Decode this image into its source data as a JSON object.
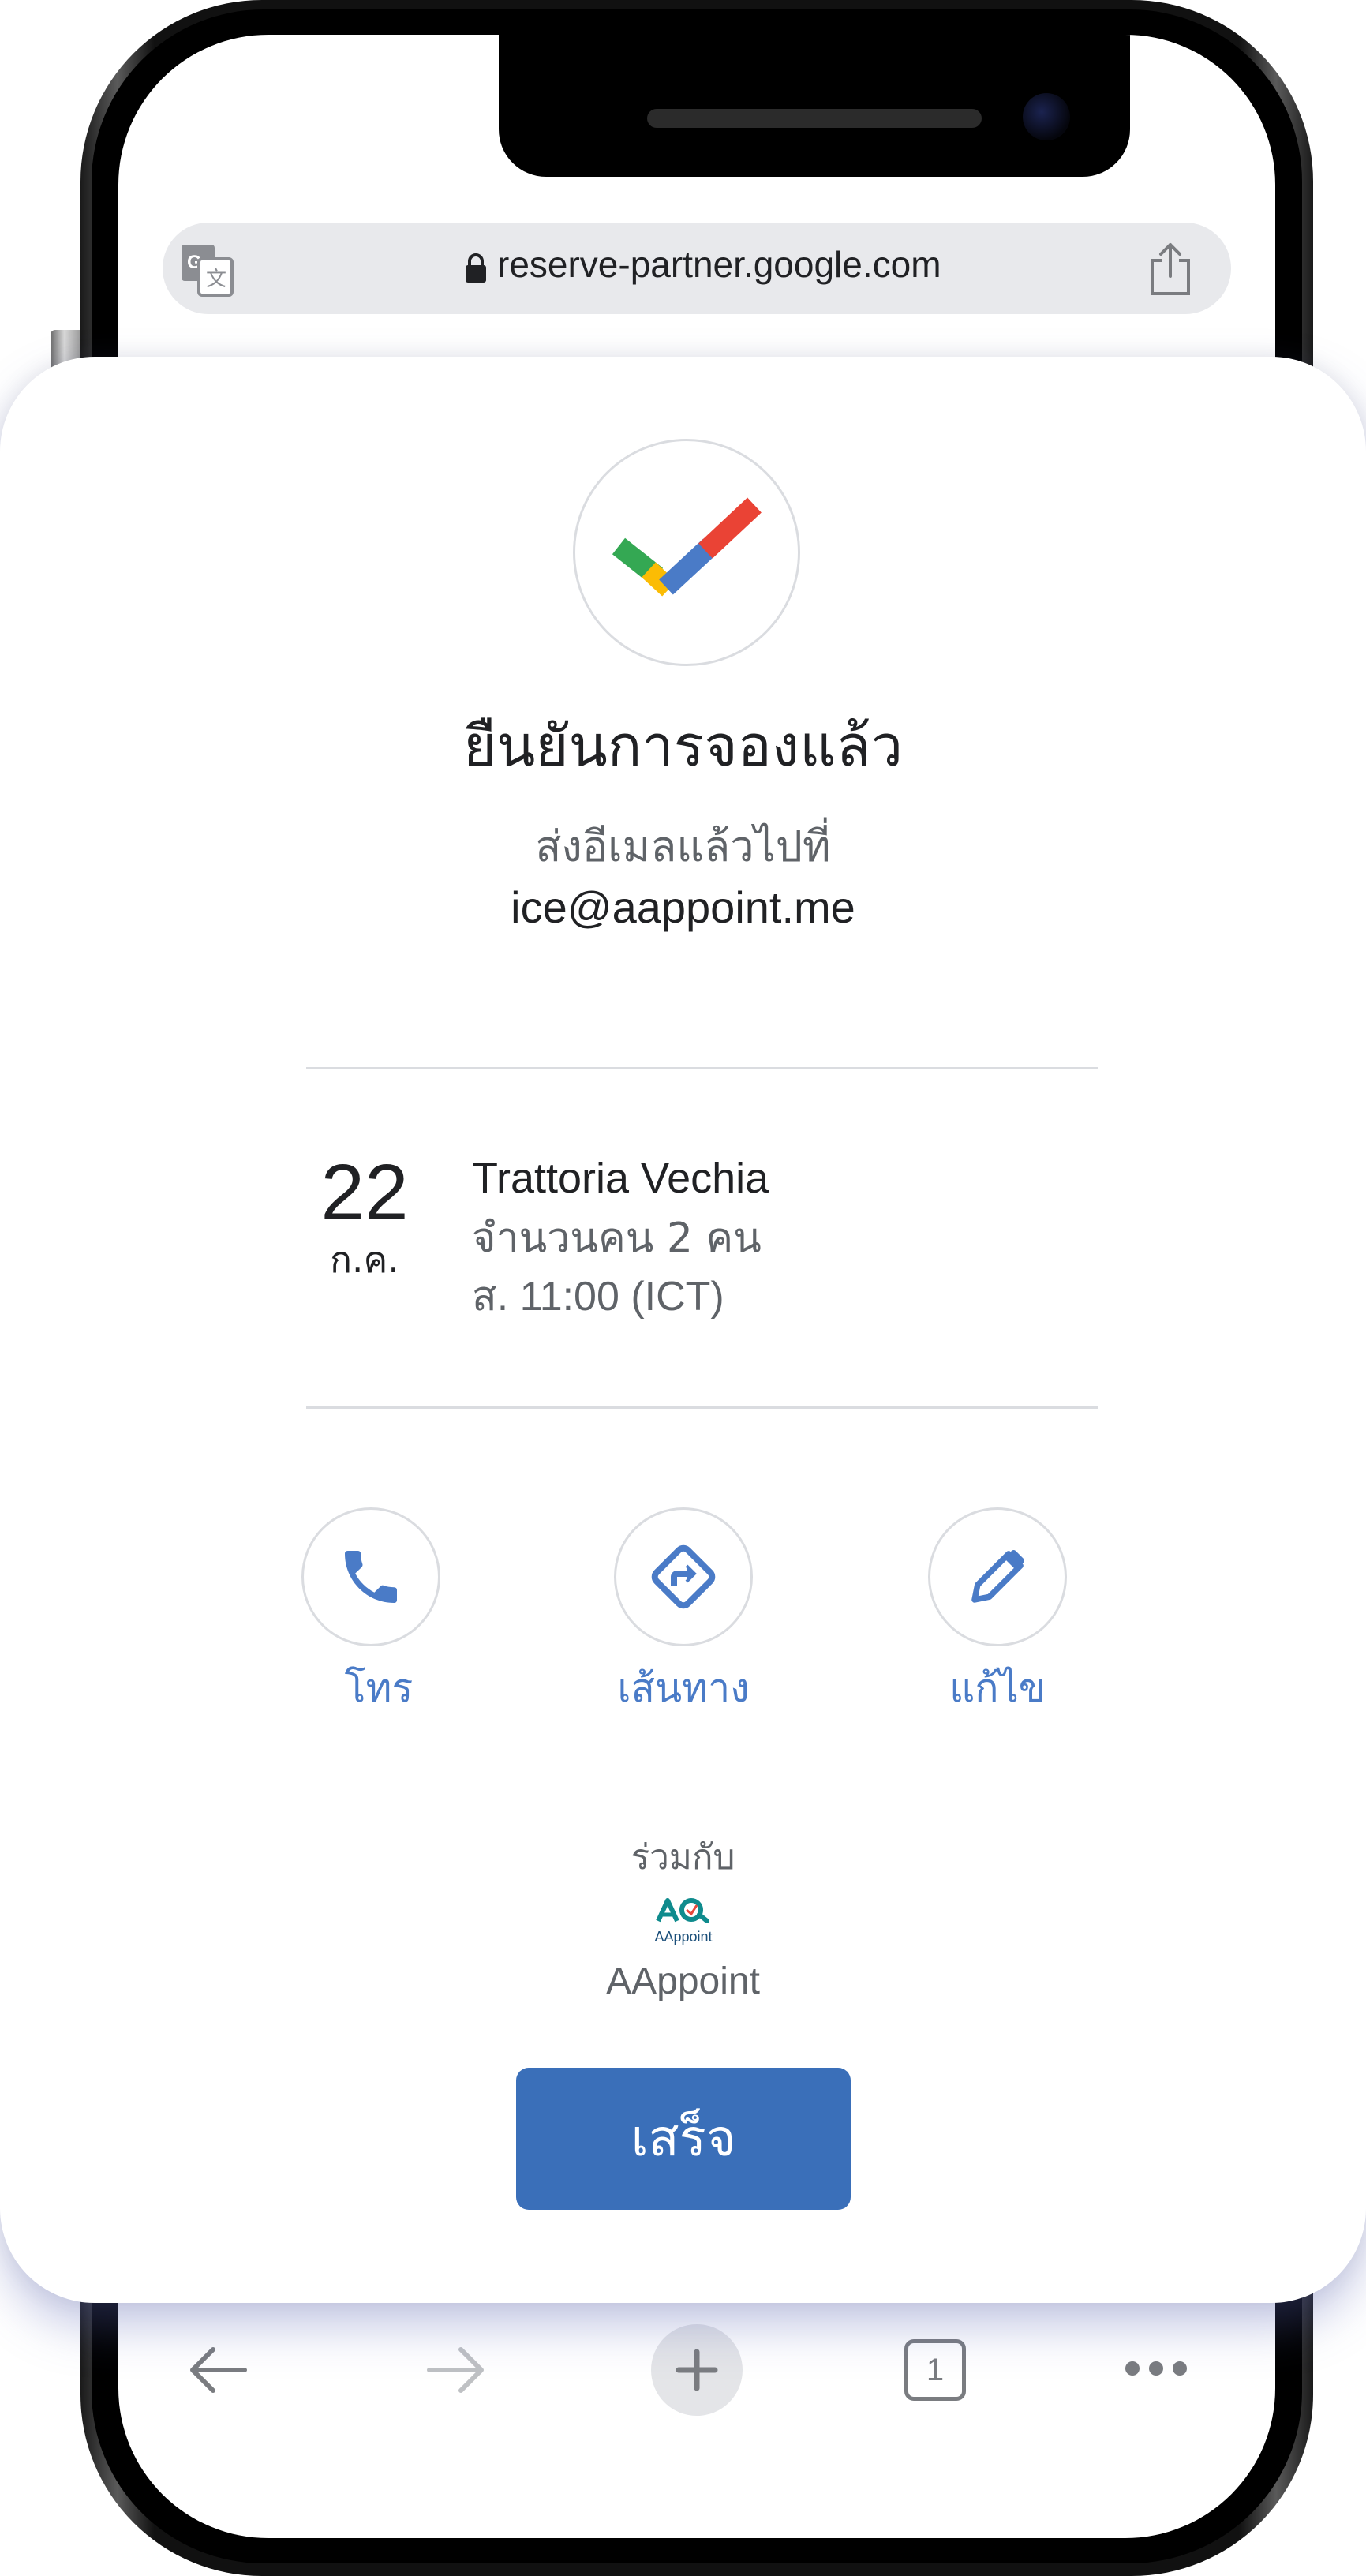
{
  "browser": {
    "url": "reserve-partner.google.com",
    "tab_count": "1",
    "icons": {
      "translate": "translate-icon",
      "lock": "lock-icon",
      "share": "share-icon",
      "back": "arrow-left-icon",
      "forward": "arrow-right-icon",
      "new_tab": "plus-icon",
      "tabs": "tabs-icon",
      "menu": "more-horizontal-icon"
    }
  },
  "confirmation": {
    "title": "ยืนยันการจองแล้ว",
    "sent_to_label": "ส่งอีเมลแล้วไปที่",
    "email": "ice@aappoint.me"
  },
  "booking": {
    "day": "22",
    "month": "ก.ค.",
    "restaurant": "Trattoria Vechia",
    "party": "จำนวนคน 2 คน",
    "time": "ส.  11:00  (ICT)"
  },
  "actions": [
    {
      "label": "โทร",
      "icon": "phone-icon"
    },
    {
      "label": "เส้นทาง",
      "icon": "directions-icon"
    },
    {
      "label": "แก้ไข",
      "icon": "pencil-icon"
    }
  ],
  "partner": {
    "with_label": "ร่วมกับ",
    "logo_text": "AAppoint",
    "name": "AAppoint"
  },
  "done_button": "เสร็จ",
  "colors": {
    "accent": "#3a6fb9",
    "link": "#4a7bc7",
    "check_green": "#34a853",
    "check_yellow": "#fbbc04",
    "check_blue": "#4a7bc7",
    "check_red": "#ea4335",
    "partner_teal": "#0f8b8d"
  }
}
